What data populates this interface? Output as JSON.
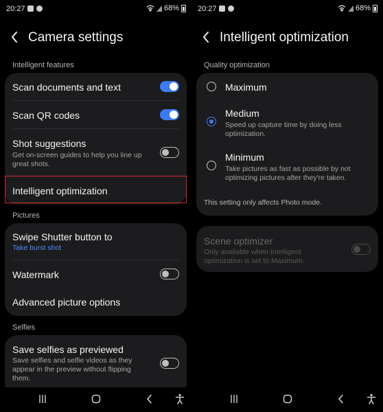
{
  "status_left": {
    "time": "20:27",
    "battery": "68%"
  },
  "status_right": {
    "time": "20:27",
    "battery": "68%"
  },
  "camera_settings": {
    "title": "Camera settings",
    "sections": {
      "intelligent_features": "Intelligent features",
      "pictures": "Pictures",
      "selfies": "Selfies"
    },
    "items": {
      "scan_documents": {
        "label": "Scan documents and text",
        "enabled": true
      },
      "scan_qr": {
        "label": "Scan QR codes",
        "enabled": true
      },
      "shot_suggestions": {
        "label": "Shot suggestions",
        "description": "Get on-screen guides to help you line up great shots.",
        "enabled": false
      },
      "intelligent_optimization": {
        "label": "Intelligent optimization"
      },
      "swipe_shutter": {
        "label": "Swipe Shutter button to",
        "value": "Take burst shot"
      },
      "watermark": {
        "label": "Watermark",
        "enabled": false
      },
      "advanced_picture": {
        "label": "Advanced picture options"
      },
      "save_selfies": {
        "label": "Save selfies as previewed",
        "description": "Save selfies and selfie videos as they appear in the preview without flipping them.",
        "enabled": false
      }
    }
  },
  "intelligent_optimization": {
    "title": "Intelligent optimization",
    "section": "Quality optimization",
    "options": {
      "maximum": {
        "label": "Maximum",
        "selected": false
      },
      "medium": {
        "label": "Medium",
        "description": "Speed up capture time by doing less optimization.",
        "selected": true
      },
      "minimum": {
        "label": "Minimum",
        "description": "Take pictures as fast as possible by not optimizing pictures after they're taken.",
        "selected": false
      }
    },
    "note": "This setting only affects Photo mode.",
    "scene_optimizer": {
      "label": "Scene optimizer",
      "description": "Only available when Intelligent optimization is set to Maximum.",
      "enabled": false,
      "disabled": true
    }
  },
  "icons": [
    "back-arrow-icon",
    "recents-icon",
    "home-icon",
    "back-icon",
    "accessibility-icon",
    "wifi-icon",
    "signal-icon",
    "battery-icon"
  ],
  "colors": {
    "accent": "#3e7bf0",
    "highlight": "#d82c2c",
    "card": "#1c1c1e",
    "link": "#4a8cf7"
  }
}
